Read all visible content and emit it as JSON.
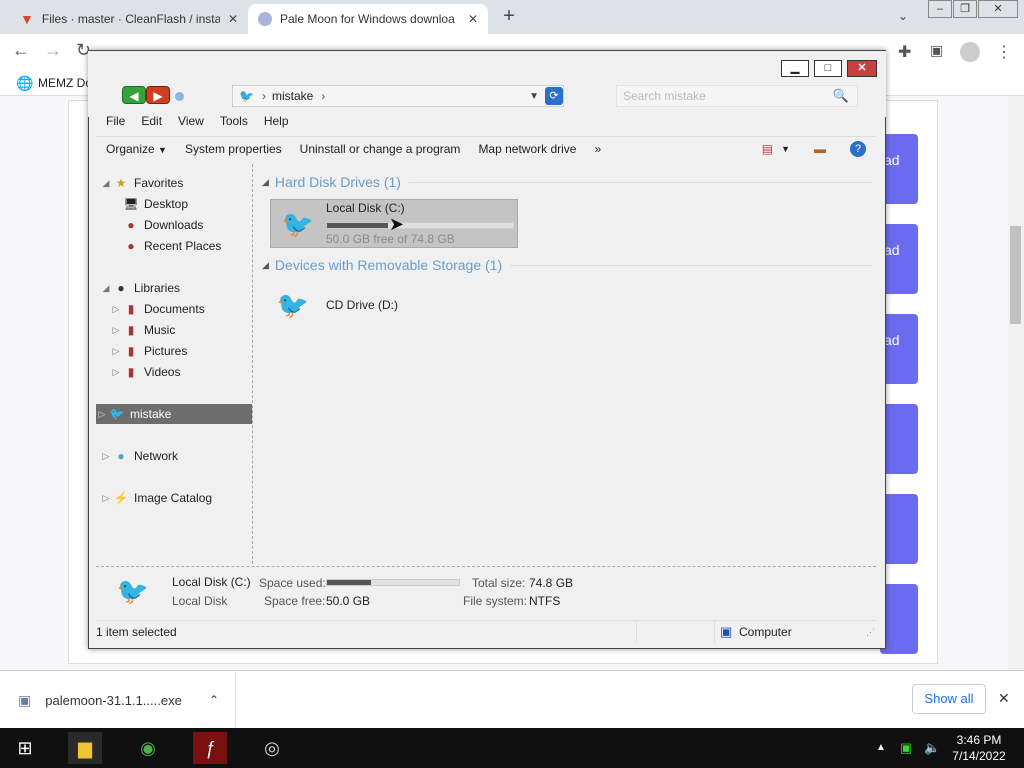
{
  "browser": {
    "tabs": [
      {
        "label": "Files · master · CleanFlash / instal",
        "icon": "gitlab-icon"
      },
      {
        "label": "Pale Moon for Windows downloa",
        "icon": "palemoon-icon"
      }
    ],
    "bookmark": "MEMZ Do",
    "page_buttons": [
      "ad",
      "ad",
      "ad",
      "",
      "",
      ""
    ],
    "download": {
      "filename": "palemoon-31.1.1.....exe",
      "show_all": "Show all"
    }
  },
  "explorer": {
    "address": {
      "path": "mistake"
    },
    "search": {
      "placeholder": "Search mistake"
    },
    "menu": [
      "File",
      "Edit",
      "View",
      "Tools",
      "Help"
    ],
    "commands": [
      "Organize",
      "System properties",
      "Uninstall or change a program",
      "Map network drive",
      "»"
    ],
    "nav": {
      "favorites": {
        "label": "Favorites",
        "items": [
          "Desktop",
          "Downloads",
          "Recent Places"
        ]
      },
      "libraries": {
        "label": "Libraries",
        "items": [
          "Documents",
          "Music",
          "Pictures",
          "Videos"
        ]
      },
      "mistake": "mistake",
      "network": "Network",
      "image_catalog": "Image Catalog"
    },
    "groups": {
      "hdd": {
        "label": "Hard Disk Drives (1)"
      },
      "removable": {
        "label": "Devices with Removable Storage (1)"
      }
    },
    "drives": {
      "c": {
        "name": "Local Disk (C:)",
        "free_text": "50.0 GB free of 74.8 GB",
        "used_fraction": 0.33
      },
      "d": {
        "name": "CD Drive (D:)"
      }
    },
    "details": {
      "name": "Local Disk (C:)",
      "type": "Local Disk",
      "space_used_label": "Space used:",
      "space_used_fraction": 0.33,
      "space_free_label": "Space free:",
      "space_free": "50.0 GB",
      "total_size_label": "Total size:",
      "total_size": "74.8 GB",
      "file_system_label": "File system:",
      "file_system": "NTFS"
    },
    "status": {
      "selected": "1 item selected",
      "location": "Computer"
    }
  },
  "taskbar": {
    "time": "3:46 PM",
    "date": "7/14/2022"
  }
}
